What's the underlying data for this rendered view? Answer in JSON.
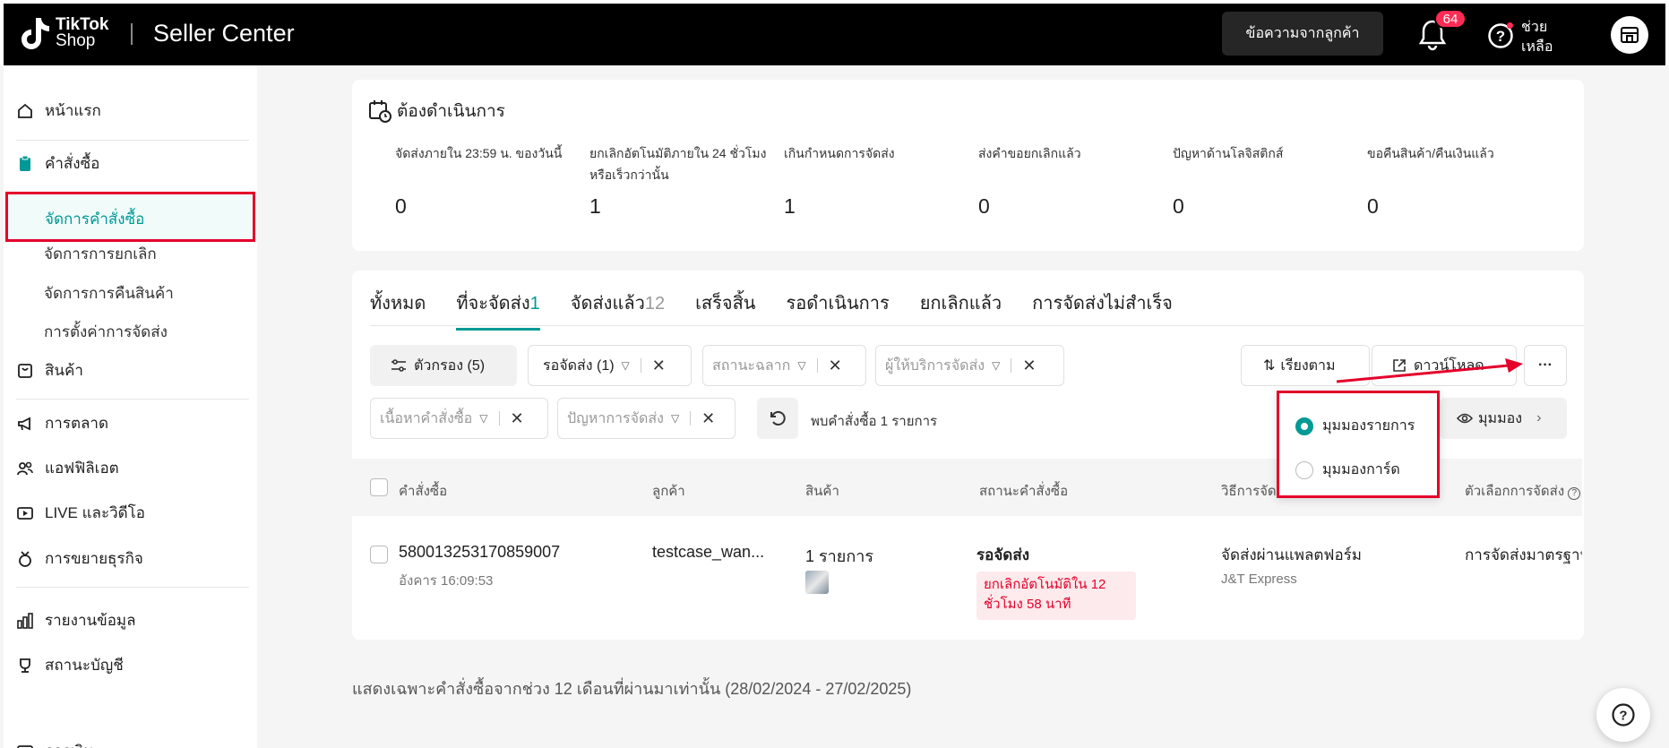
{
  "header": {
    "logo_line1": "TikTok",
    "logo_line2": "Shop",
    "app_title": "Seller Center",
    "messages_button": "ข้อความจากลูกค้า",
    "notification_count": "64",
    "help_label_1": "ช่วย",
    "help_label_2": "เหลือ"
  },
  "sidebar": {
    "home": "หน้าแรก",
    "orders": "คำสั่งซื้อ",
    "orders_sub": [
      "จัดการคำสั่งซื้อ",
      "จัดการการยกเลิก",
      "จัดการการคืนสินค้า",
      "การตั้งค่าการจัดส่ง"
    ],
    "products": "สินค้า",
    "marketing": "การตลาด",
    "affiliate": "แอฟฟิลิเอต",
    "live_video": "LIVE และวิดีโอ",
    "business_growth": "การขยายธุรกิจ",
    "reports": "รายงานข้อมูล",
    "account_status": "สถานะบัญชี",
    "finance": "การเงิน"
  },
  "todo": {
    "title": "ต้องดำเนินการ",
    "items": [
      {
        "label": "จัดส่งภายใน 23:59 น. ของวันนี้",
        "value": "0"
      },
      {
        "label": "ยกเลิกอัตโนมัติภายใน 24 ชั่วโมงหรือเร็วกว่านั้น",
        "value": "1"
      },
      {
        "label": "เกินกำหนดการจัดส่ง",
        "value": "1"
      },
      {
        "label": "ส่งคำขอยกเลิกแล้ว",
        "value": "0"
      },
      {
        "label": "ปัญหาด้านโลจิสติกส์",
        "value": "0"
      },
      {
        "label": "ขอคืนสินค้า/คืนเงินแล้ว",
        "value": "0"
      }
    ]
  },
  "tabs": [
    {
      "label": "ทั้งหมด",
      "count": ""
    },
    {
      "label": "ที่จะจัดส่ง",
      "count": "1"
    },
    {
      "label": "จัดส่งแล้ว",
      "count": "12"
    },
    {
      "label": "เสร็จสิ้น",
      "count": ""
    },
    {
      "label": "รอดำเนินการ",
      "count": ""
    },
    {
      "label": "ยกเลิกแล้ว",
      "count": ""
    },
    {
      "label": "การจัดส่งไม่สำเร็จ",
      "count": ""
    }
  ],
  "filters": {
    "filter_button": "ตัวกรอง (5)",
    "status_filter": "รอจัดส่ง (1)",
    "label_status_placeholder": "สถานะฉลาก",
    "carrier_placeholder": "ผู้ให้บริการจัดส่ง",
    "order_content_placeholder": "เนื้อหาคำสั่งซื้อ",
    "shipping_issue_placeholder": "ปัญหาการจัดส่ง",
    "result_text": "พบคำสั่งซื้อ 1 รายการ",
    "sort_button": "เรียงตาม",
    "download_button": "ดาวน์โหลด",
    "more_button": "···",
    "view_button": "มุมมอง"
  },
  "view_popup": {
    "list_view": "มุมมองรายการ",
    "card_view": "มุมมองการ์ด"
  },
  "table": {
    "headers": [
      "คำสั่งซื้อ",
      "ลูกค้า",
      "สินค้า",
      "สถานะคำสั่งซื้อ",
      "วิธีการจัดส่ง",
      "ตัวเลือกการจัดส่ง"
    ],
    "header_shipping_method_visible": "วิธีการจัด",
    "row": {
      "order_id": "580013253170859007",
      "order_time": "อังคาร 16:09:53",
      "customer": "testcase_wan...",
      "product_count": "1 รายการ",
      "status": "รอจัดส่ง",
      "status_warning": "ยกเลิกอัตโนมัติใน 12 ชั่วโมง 58 นาที",
      "shipping_method": "จัดส่งผ่านแพลตฟอร์ม",
      "carrier": "J&T Express",
      "shipping_option": "การจัดส่งมาตรฐาน"
    }
  },
  "footnote": "แสดงเฉพาะคำสั่งซื้อจากช่วง 12 เดือนที่ผ่านมาเท่านั้น (28/02/2024 - 27/02/2025)",
  "colors": {
    "accent": "#009995",
    "alert": "#e4002b",
    "topbar": "#000000"
  }
}
